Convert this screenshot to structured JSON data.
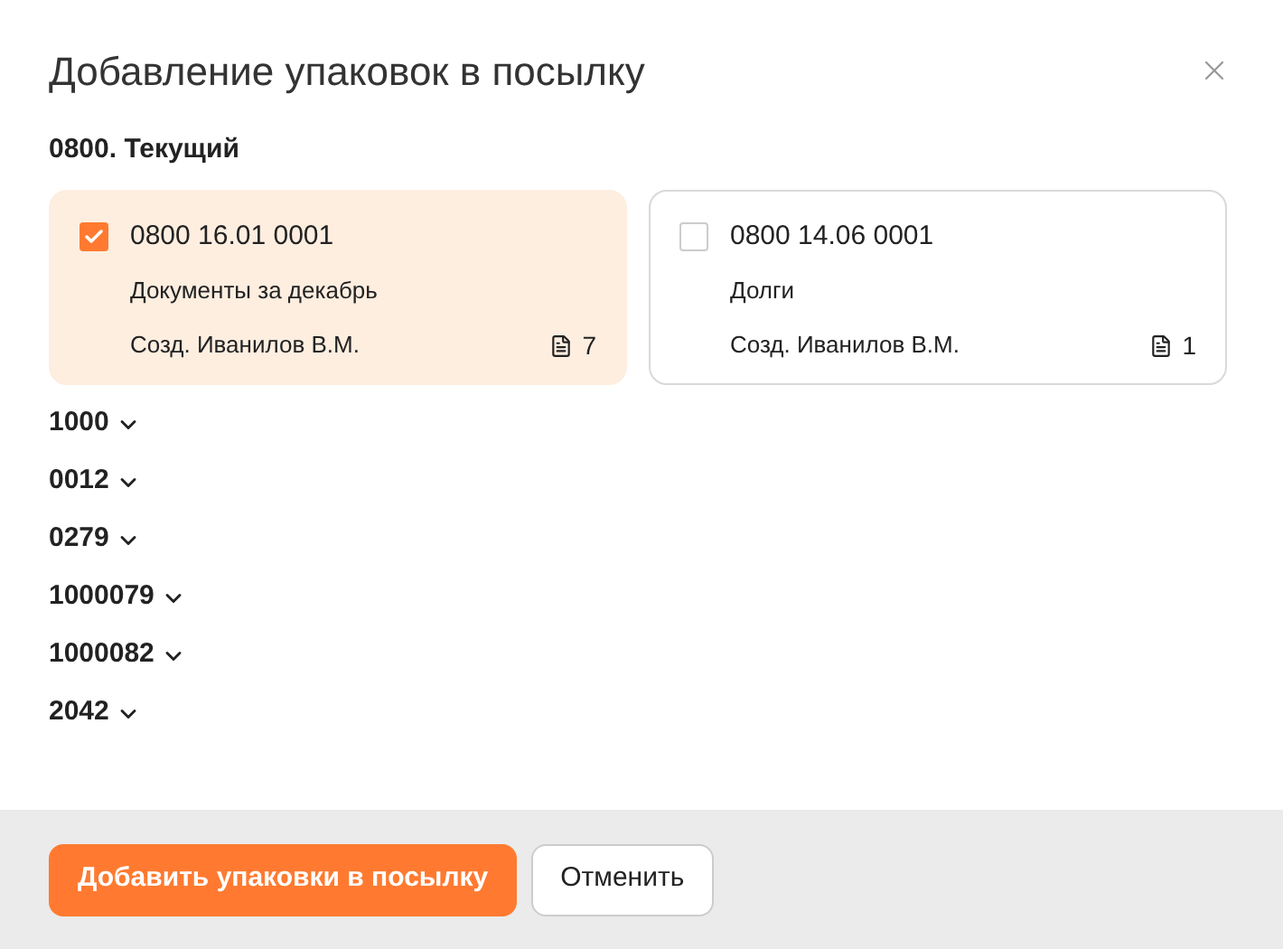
{
  "dialog": {
    "title": "Добавление упаковок в посылку"
  },
  "current_group": {
    "label": "0800. Текущий",
    "packages": [
      {
        "code": "0800 16.01 0001",
        "description": "Документы за декабрь",
        "author": "Созд. Иванилов В.М.",
        "count": "7",
        "checked": true
      },
      {
        "code": "0800 14.06 0001",
        "description": "Долги",
        "author": "Созд. Иванилов В.М.",
        "count": "1",
        "checked": false
      }
    ]
  },
  "groups": [
    {
      "label": "1000",
      "expanded": false
    },
    {
      "label": "0012",
      "expanded": false
    },
    {
      "label": "0279",
      "expanded": false
    },
    {
      "label": "1000079",
      "expanded": false
    },
    {
      "label": "1000082",
      "expanded": false
    },
    {
      "label": "2042",
      "expanded": false
    }
  ],
  "buttons": {
    "primary": "Добавить упаковки в посылку",
    "secondary": "Отменить"
  }
}
